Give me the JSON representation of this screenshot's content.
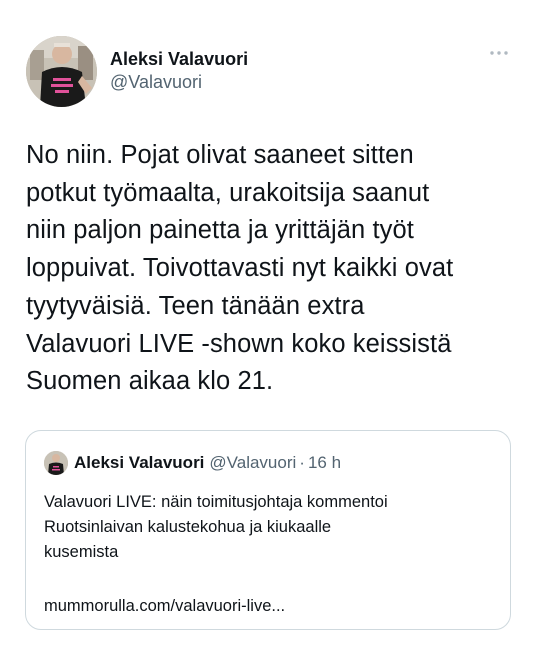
{
  "author": {
    "display_name": "Aleksi Valavuori",
    "handle": "@Valavuori"
  },
  "tweet": {
    "text": "No niin. Pojat olivat saaneet sitten\npotkut työmaalta, urakoitsija saanut\nniin paljon painetta ja yrittäjän työt\nloppuivat. Toivottavasti nyt kaikki ovat\ntyytyväisiä. Teen tänään extra\nValavuori LIVE -shown koko keissistä\nSuomen aikaa klo 21."
  },
  "quoted_tweet": {
    "display_name": "Aleksi Valavuori",
    "handle": "@Valavuori",
    "separator": "·",
    "time": "16 h",
    "text": "Valavuori LIVE: näin toimitusjohtaja kommentoi\nRuotsinlaivan kalustekohua ja kiukaalle\nkusemista",
    "link": "mummorulla.com/valavuori-live..."
  },
  "icons": {
    "more": "more-horizontal-icon"
  },
  "colors": {
    "text": "#0f1419",
    "secondary_text": "#536471",
    "border": "#cfd9de",
    "avatar_shirt": "#1a1a1a",
    "avatar_print": "#e0529a"
  }
}
